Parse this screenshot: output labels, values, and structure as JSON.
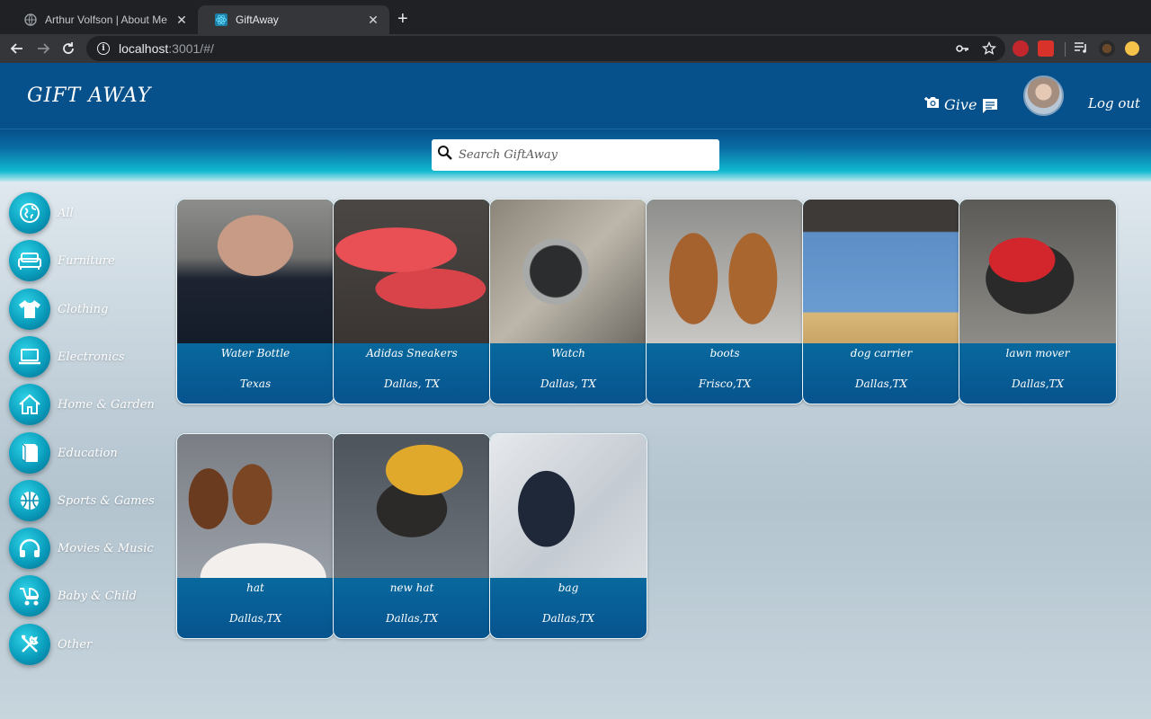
{
  "browser": {
    "tabs": [
      {
        "title": "Arthur Volfson | About Me",
        "active": false
      },
      {
        "title": "GiftAway",
        "active": true
      }
    ],
    "url_host": "localhost",
    "url_rest": ":3001/#/"
  },
  "header": {
    "brand": "GIFT AWAY",
    "give_label": "Give",
    "logout_label": "Log out"
  },
  "search": {
    "placeholder": "Search GiftAway"
  },
  "categories": [
    {
      "label": "All",
      "icon": "globe-icon"
    },
    {
      "label": "Furniture",
      "icon": "sofa-icon"
    },
    {
      "label": "Clothing",
      "icon": "shirt-icon"
    },
    {
      "label": "Electronics",
      "icon": "laptop-icon"
    },
    {
      "label": "Home & Garden",
      "icon": "house-icon"
    },
    {
      "label": "Education",
      "icon": "book-icon"
    },
    {
      "label": "Sports & Games",
      "icon": "basketball-icon"
    },
    {
      "label": "Movies & Music",
      "icon": "headphones-icon"
    },
    {
      "label": "Baby & Child",
      "icon": "stroller-icon"
    },
    {
      "label": "Other",
      "icon": "tools-icon"
    }
  ],
  "items": [
    {
      "name": "Water Bottle",
      "location": "Texas"
    },
    {
      "name": "Adidas Sneakers",
      "location": "Dallas, TX"
    },
    {
      "name": "Watch",
      "location": "Dallas, TX"
    },
    {
      "name": "boots",
      "location": "Frisco,TX"
    },
    {
      "name": "dog carrier",
      "location": "Dallas,TX"
    },
    {
      "name": "lawn mover",
      "location": "Dallas,TX"
    },
    {
      "name": "hat",
      "location": "Dallas,TX"
    },
    {
      "name": "new hat",
      "location": "Dallas,TX"
    },
    {
      "name": "bag",
      "location": "Dallas,TX"
    }
  ]
}
